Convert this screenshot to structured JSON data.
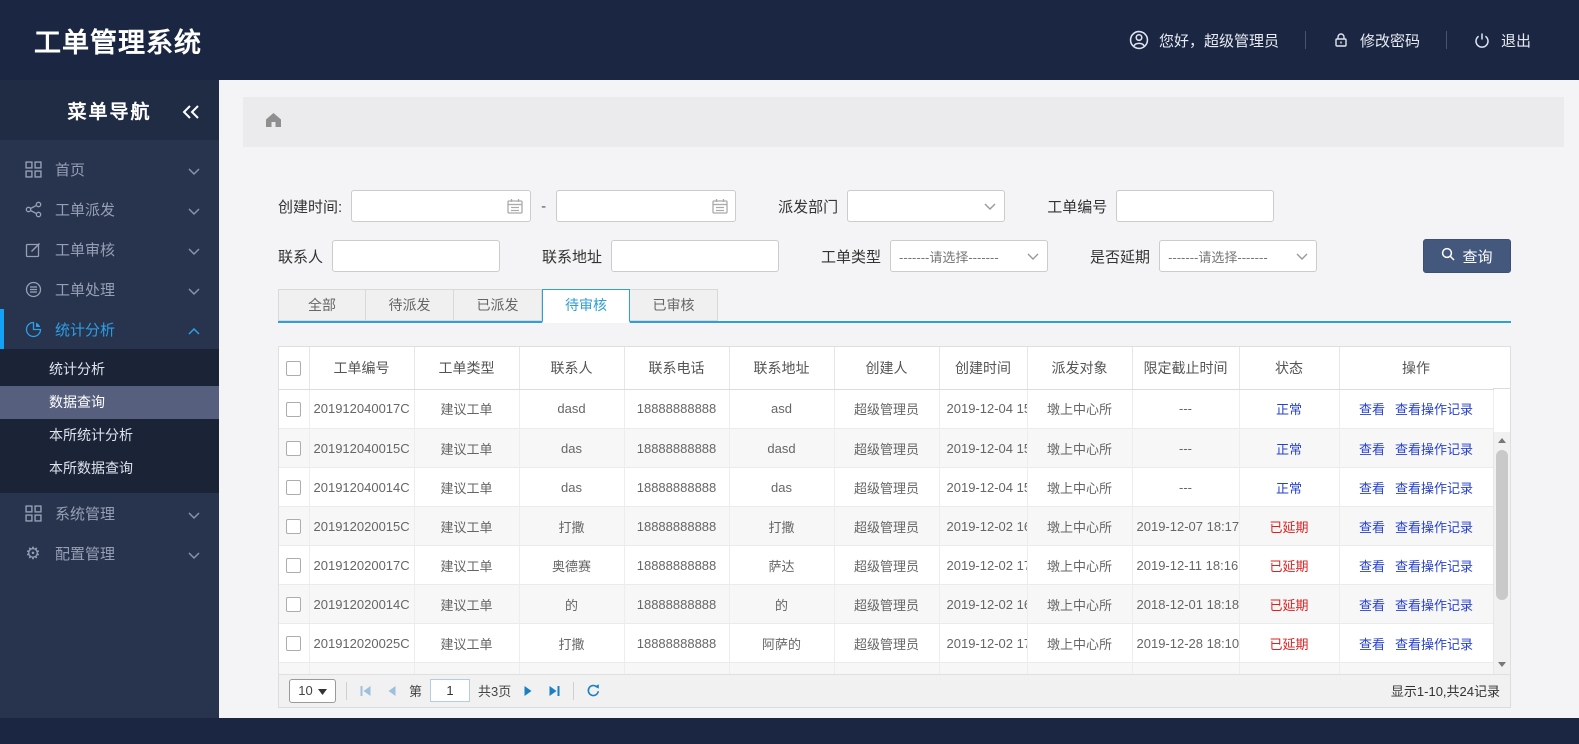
{
  "header": {
    "title": "工单管理系统",
    "greeting": "您好，超级管理员",
    "change_password": "修改密码",
    "logout": "退出"
  },
  "sidebar": {
    "nav_title": "菜单导航",
    "items": [
      {
        "label": "首页",
        "icon": "grid-icon"
      },
      {
        "label": "工单派发",
        "icon": "share-icon"
      },
      {
        "label": "工单审核",
        "icon": "edit-icon"
      },
      {
        "label": "工单处理",
        "icon": "database-icon"
      },
      {
        "label": "统计分析",
        "icon": "pie-chart-icon",
        "active": true,
        "expanded": true
      },
      {
        "label": "系统管理",
        "icon": "squares-icon"
      },
      {
        "label": "配置管理",
        "icon": "gear-icon"
      }
    ],
    "submenu": [
      {
        "label": "统计分析"
      },
      {
        "label": "数据查询",
        "selected": true
      },
      {
        "label": "本所统计分析"
      },
      {
        "label": "本所数据查询"
      }
    ]
  },
  "filters": {
    "create_time": {
      "label": "创建时间:",
      "value_start": "",
      "value_end": "",
      "separator": "-"
    },
    "dispatch_dept": {
      "label": "派发部门",
      "value": ""
    },
    "order_no": {
      "label": "工单编号",
      "value": ""
    },
    "contact": {
      "label": "联系人",
      "value": ""
    },
    "contact_addr": {
      "label": "联系地址",
      "value": ""
    },
    "order_type": {
      "label": "工单类型",
      "value": "-------请选择-------"
    },
    "is_delayed": {
      "label": "是否延期",
      "value": "-------请选择-------"
    },
    "search_button": "查询"
  },
  "tabs": {
    "items": [
      {
        "label": "全部"
      },
      {
        "label": "待派发"
      },
      {
        "label": "已派发"
      },
      {
        "label": "待审核",
        "active": true
      },
      {
        "label": "已审核"
      }
    ]
  },
  "table": {
    "columns": [
      "工单编号",
      "工单类型",
      "联系人",
      "联系电话",
      "联系地址",
      "创建人",
      "创建时间",
      "派发对象",
      "限定截止时间",
      "状态",
      "操作"
    ],
    "actions": {
      "view": "查看",
      "view_log": "查看操作记录"
    },
    "rows": [
      {
        "no": "201912040017C",
        "type": "建议工单",
        "contact": "dasd",
        "phone": "18888888888",
        "addr": "asd",
        "creator": "超级管理员",
        "ctime": "2019-12-04 15",
        "target": "墩上中心所",
        "deadline": "---",
        "status": "正常"
      },
      {
        "no": "201912040015C",
        "type": "建议工单",
        "contact": "das",
        "phone": "18888888888",
        "addr": "dasd",
        "creator": "超级管理员",
        "ctime": "2019-12-04 15",
        "target": "墩上中心所",
        "deadline": "---",
        "status": "正常"
      },
      {
        "no": "201912040014C",
        "type": "建议工单",
        "contact": "das",
        "phone": "18888888888",
        "addr": "das",
        "creator": "超级管理员",
        "ctime": "2019-12-04 15",
        "target": "墩上中心所",
        "deadline": "---",
        "status": "正常"
      },
      {
        "no": "201912020015C",
        "type": "建议工单",
        "contact": "打撒",
        "phone": "18888888888",
        "addr": "打撒",
        "creator": "超级管理员",
        "ctime": "2019-12-02 16",
        "target": "墩上中心所",
        "deadline": "2019-12-07 18:17",
        "status": "已延期"
      },
      {
        "no": "201912020017C",
        "type": "建议工单",
        "contact": "奥德赛",
        "phone": "18888888888",
        "addr": "萨达",
        "creator": "超级管理员",
        "ctime": "2019-12-02 17",
        "target": "墩上中心所",
        "deadline": "2019-12-11 18:16",
        "status": "已延期"
      },
      {
        "no": "201912020014C",
        "type": "建议工单",
        "contact": "的",
        "phone": "18888888888",
        "addr": "的",
        "creator": "超级管理员",
        "ctime": "2019-12-02 16",
        "target": "墩上中心所",
        "deadline": "2018-12-01 18:18",
        "status": "已延期"
      },
      {
        "no": "201912020025C",
        "type": "建议工单",
        "contact": "打撒",
        "phone": "18888888888",
        "addr": "阿萨的",
        "creator": "超级管理员",
        "ctime": "2019-12-02 17",
        "target": "墩上中心所",
        "deadline": "2019-12-28 18:10",
        "status": "已延期"
      }
    ]
  },
  "pagination": {
    "page_size": "10",
    "page_label_prefix": "第",
    "current_page": "1",
    "total_pages_label": "共3页",
    "summary": "显示1-10,共24记录"
  },
  "colors": {
    "header_navy": "#1b2742",
    "sidebar_navy": "#28334d",
    "accent_blue": "#2e9fd9",
    "active_menu_blue": "#2d9fe4",
    "link_blue": "#2742d0",
    "status_normal_blue": "#2742d0",
    "status_delayed_red": "#e01f1f",
    "query_button_navy": "#44587e"
  }
}
